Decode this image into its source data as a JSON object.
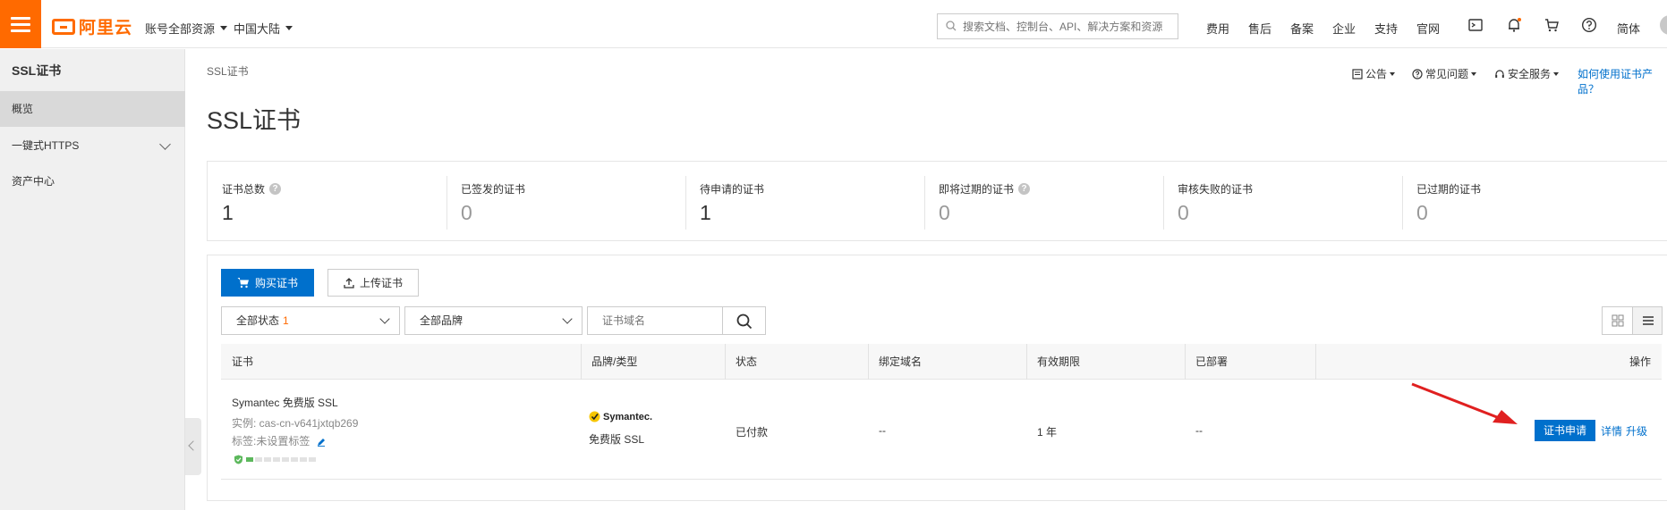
{
  "topbar": {
    "logo_text": "阿里云",
    "account_dd": "账号全部资源",
    "region_dd": "中国大陆",
    "search_placeholder": "搜索文档、控制台、API、解决方案和资源",
    "nav": [
      "费用",
      "售后",
      "备案",
      "企业",
      "支持",
      "官网"
    ],
    "lang": "简体",
    "accent": "#ff6a00"
  },
  "sidebar": {
    "title": "SSL证书",
    "items": [
      {
        "label": "概览",
        "active": true
      },
      {
        "label": "一键式HTTPS",
        "active": false
      },
      {
        "label": "资产中心",
        "active": false
      }
    ]
  },
  "header": {
    "breadcrumb": "SSL证书",
    "title": "SSL证书",
    "links": {
      "notice": "公告",
      "faq": "常见问题",
      "security": "安全服务",
      "howto": "如何使用证书产品？"
    }
  },
  "stats": [
    {
      "label": "证书总数",
      "value": "1",
      "help": true
    },
    {
      "label": "已签发的证书",
      "value": "0",
      "help": false
    },
    {
      "label": "待申请的证书",
      "value": "1",
      "help": false
    },
    {
      "label": "即将过期的证书",
      "value": "0",
      "help": true
    },
    {
      "label": "审核失败的证书",
      "value": "0",
      "help": false
    },
    {
      "label": "已过期的证书",
      "value": "0",
      "help": false
    }
  ],
  "toolbar": {
    "buy_label": "购买证书",
    "upload_label": "上传证书",
    "status_select": "全部状态",
    "status_count": "1",
    "brand_select": "全部品牌",
    "domain_placeholder": "证书域名"
  },
  "table": {
    "columns": [
      "证书",
      "品牌/类型",
      "状态",
      "绑定域名",
      "有效期限",
      "已部署",
      "操作"
    ],
    "rows": [
      {
        "name": "Symantec 免费版 SSL",
        "instance": "实例: cas-cn-v641jxtqb269",
        "tags": "标签:未设置标签",
        "progress_steps": 8,
        "progress_done": 1,
        "brand_logo": "Symantec.",
        "brand_type": "免费版 SSL",
        "status": "已付款",
        "domain": "--",
        "validity": "1 年",
        "deployed": "--",
        "actions": {
          "apply": "证书申请",
          "detail": "详情",
          "upgrade": "升级"
        }
      }
    ]
  },
  "colors": {
    "primary": "#0070cc",
    "orange": "#ff6a00",
    "arrow": "#e02020"
  }
}
